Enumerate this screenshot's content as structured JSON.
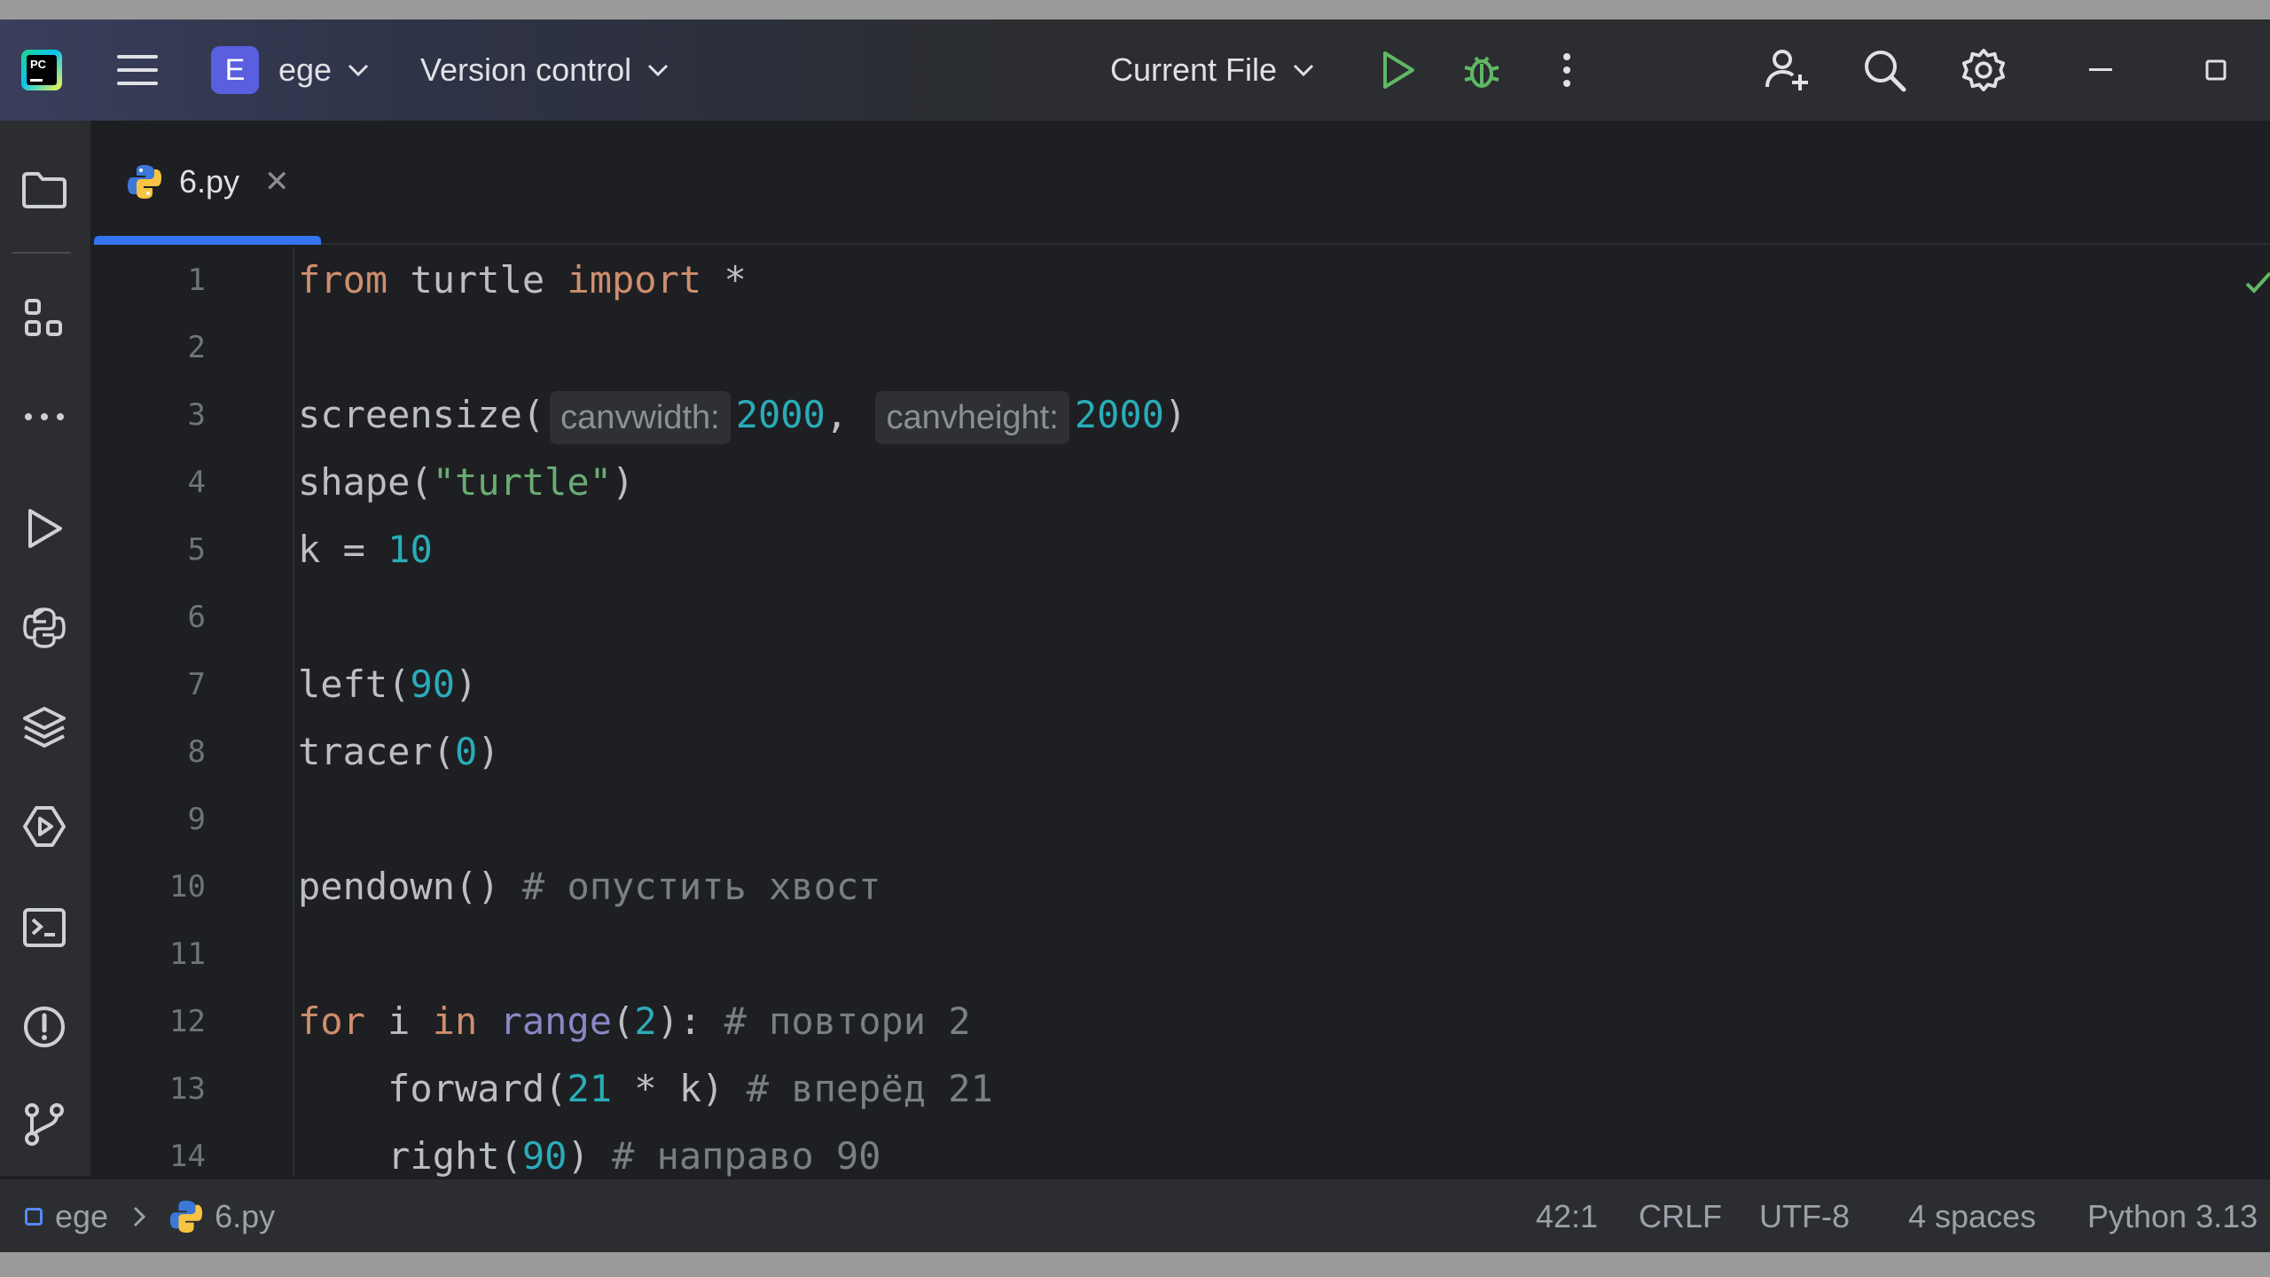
{
  "titlebar": {
    "project_badge": "E",
    "project_name": "ege",
    "vcs_label": "Version control",
    "run_config": "Current File"
  },
  "tabs": [
    {
      "label": "6.py",
      "close": "✕",
      "active": true
    }
  ],
  "editor": {
    "line_numbers": [
      "1",
      "2",
      "3",
      "4",
      "5",
      "6",
      "7",
      "8",
      "9",
      "10",
      "11",
      "12",
      "13",
      "14"
    ],
    "hints": {
      "canvwidth": "canvwidth:",
      "canvheight": "canvheight:"
    },
    "code": {
      "l1_from": "from",
      "l1_mod": " turtle ",
      "l1_import": "import",
      "l1_star": " *",
      "l3_fn": "screensize(",
      "l3_v1": "2000",
      "l3_comma": ", ",
      "l3_v2": "2000",
      "l3_close": ")",
      "l4_fn": "shape(",
      "l4_str": "\"turtle\"",
      "l4_close": ")",
      "l5_var": "k = ",
      "l5_num": "10",
      "l7_fn": "left(",
      "l7_num": "90",
      "l7_close": ")",
      "l8_fn": "tracer(",
      "l8_num": "0",
      "l8_close": ")",
      "l10_fn": "pendown() ",
      "l10_cm": "# опустить хвост",
      "l12_for": "for",
      "l12_i": " i ",
      "l12_in": "in",
      "l12_sp": " ",
      "l12_range": "range",
      "l12_open": "(",
      "l12_num": "2",
      "l12_close": "): ",
      "l12_cm": "# повтори 2",
      "l13_fn": "    forward(",
      "l13_num": "21",
      "l13_rest": " * k) ",
      "l13_cm": "# вперёд 21",
      "l14_fn": "    right(",
      "l14_num": "90",
      "l14_close": ") ",
      "l14_cm": "# направо 90"
    }
  },
  "statusbar": {
    "project": "ege",
    "file": "6.py",
    "position": "42:1",
    "line_sep": "CRLF",
    "encoding": "UTF-8",
    "indent": "4 spaces",
    "interpreter": "Python 3.13"
  },
  "colors": {
    "accent": "#3574f0",
    "keyword": "#cf8e6d",
    "number": "#2aacb8",
    "string": "#6aab73",
    "comment": "#7a7e85",
    "run": "#5fb865",
    "debug": "#5fb865"
  },
  "icons": [
    "main-menu-icon",
    "chevron-down-icon",
    "run-icon",
    "debug-icon",
    "more-vertical-icon",
    "add-user-icon",
    "search-icon",
    "settings-icon",
    "minimize-icon",
    "maximize-icon",
    "folder-icon",
    "structure-icon",
    "more-horizontal-icon",
    "run-tool-icon",
    "python-console-icon",
    "layers-icon",
    "services-icon",
    "terminal-icon",
    "problems-icon",
    "git-icon",
    "python-file-icon",
    "close-icon",
    "check-icon"
  ]
}
